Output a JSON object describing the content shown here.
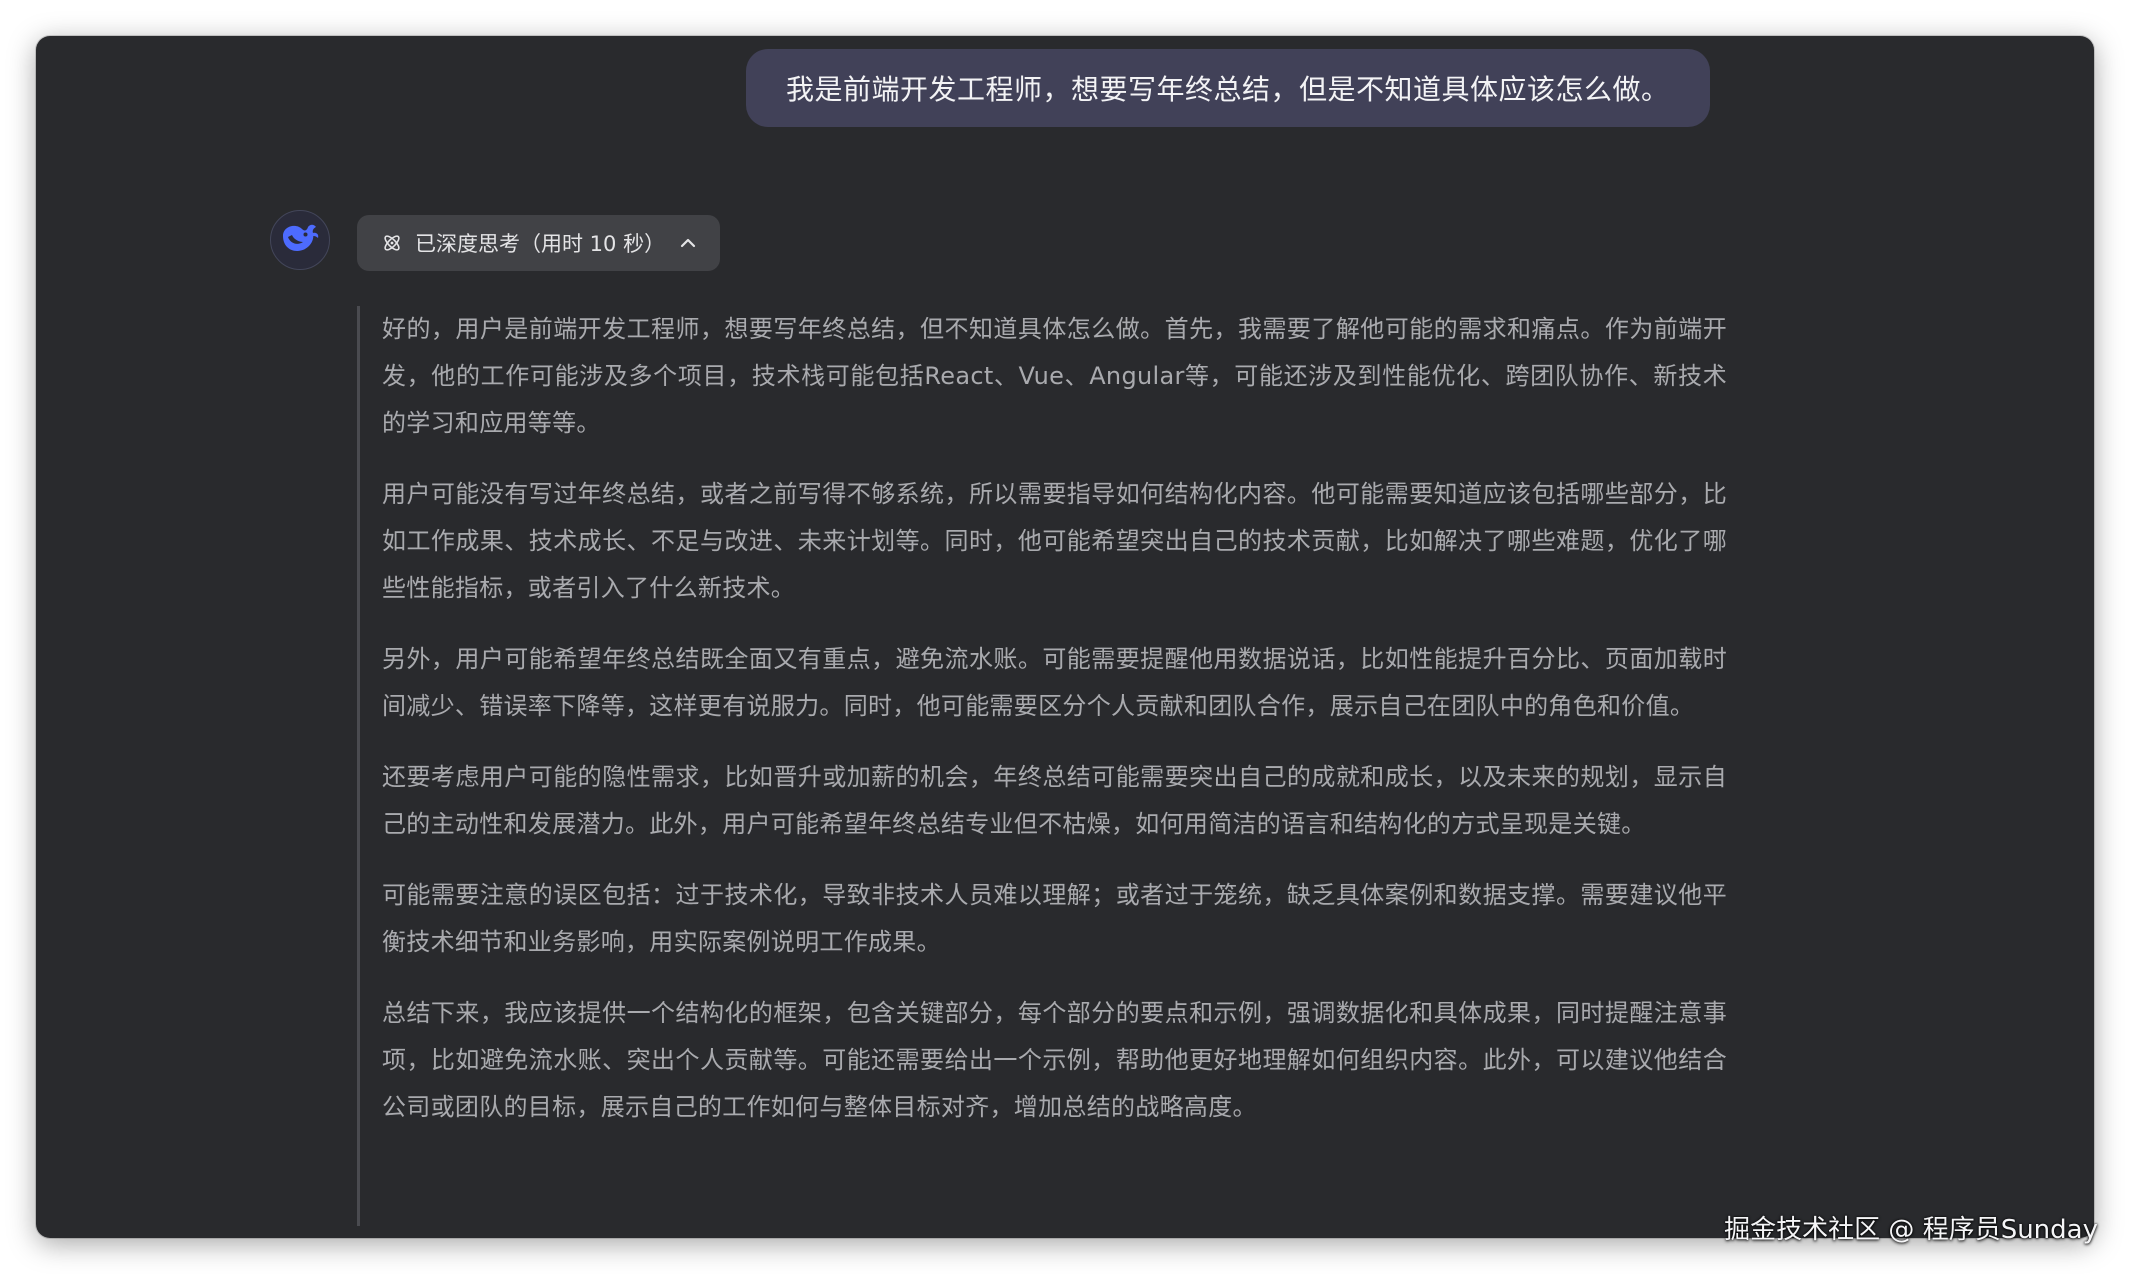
{
  "user_message": {
    "text": "我是前端开发工程师，想要写年终总结，但是不知道具体应该怎么做。"
  },
  "assistant": {
    "avatar_icon": "deepseek-whale-icon",
    "think_toggle": {
      "icon": "atom-icon",
      "label": "已深度思考（用时 10 秒）",
      "chevron": "chevron-up-icon"
    },
    "thinking_paragraphs": [
      "好的，用户是前端开发工程师，想要写年终总结，但不知道具体怎么做。首先，我需要了解他可能的需求和痛点。作为前端开发，他的工作可能涉及多个项目，技术栈可能包括React、Vue、Angular等，可能还涉及到性能优化、跨团队协作、新技术的学习和应用等等。",
      "用户可能没有写过年终总结，或者之前写得不够系统，所以需要指导如何结构化内容。他可能需要知道应该包括哪些部分，比如工作成果、技术成长、不足与改进、未来计划等。同时，他可能希望突出自己的技术贡献，比如解决了哪些难题，优化了哪些性能指标，或者引入了什么新技术。",
      "另外，用户可能希望年终总结既全面又有重点，避免流水账。可能需要提醒他用数据说话，比如性能提升百分比、页面加载时间减少、错误率下降等，这样更有说服力。同时，他可能需要区分个人贡献和团队合作，展示自己在团队中的角色和价值。",
      "还要考虑用户可能的隐性需求，比如晋升或加薪的机会，年终总结可能需要突出自己的成就和成长，以及未来的规划，显示自己的主动性和发展潜力。此外，用户可能希望年终总结专业但不枯燥，如何用简洁的语言和结构化的方式呈现是关键。",
      "可能需要注意的误区包括：过于技术化，导致非技术人员难以理解；或者过于笼统，缺乏具体案例和数据支撑。需要建议他平衡技术细节和业务影响，用实际案例说明工作成果。",
      "总结下来，我应该提供一个结构化的框架，包含关键部分，每个部分的要点和示例，强调数据化和具体成果，同时提醒注意事项，比如避免流水账、突出个人贡献等。可能还需要给出一个示例，帮助他更好地理解如何组织内容。此外，可以建议他结合公司或团队的目标，展示自己的工作如何与整体目标对齐，增加总结的战略高度。"
    ]
  },
  "watermark": "掘金技术社区 @ 程序员Sunday",
  "colors": {
    "window_bg": "#292a2d",
    "user_bubble_bg": "#414158",
    "toggle_bg": "#414246",
    "thinking_text": "#a9aaae",
    "accent": "#4d6bfe"
  }
}
